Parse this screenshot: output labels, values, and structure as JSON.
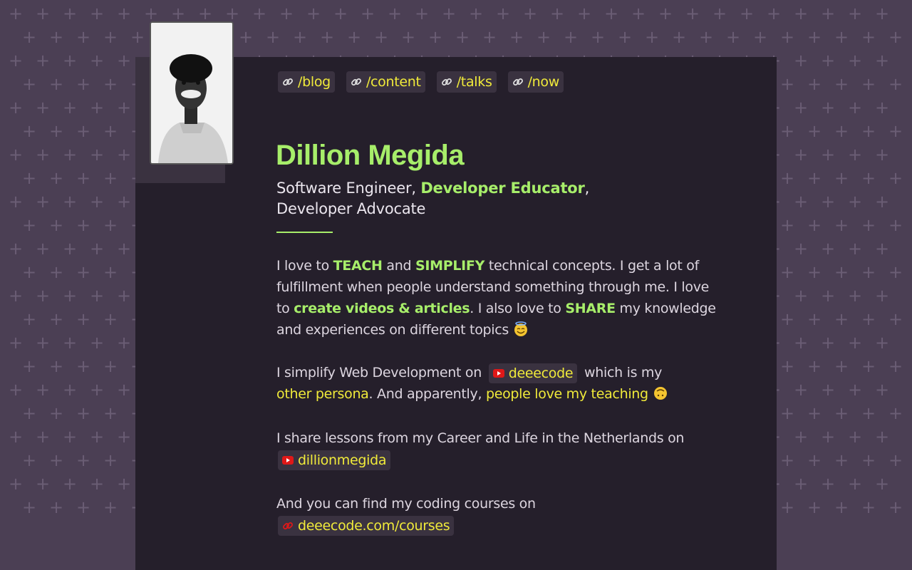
{
  "nav": [
    {
      "label": "/blog",
      "icon": "link-icon"
    },
    {
      "label": "/content",
      "icon": "link-icon"
    },
    {
      "label": "/talks",
      "icon": "link-icon"
    },
    {
      "label": "/now",
      "icon": "link-icon"
    }
  ],
  "profile": {
    "name": "Dillion Megida",
    "role_1": "Software Engineer, ",
    "role_highlight": "Developer Educator",
    "role_2": ",",
    "role_3": "Developer Advocate"
  },
  "about": {
    "p1_a": "I love to ",
    "p1_teach": "TEACH",
    "p1_b": " and ",
    "p1_simplify": "SIMPLIFY",
    "p1_c": " technical concepts. I get a lot of fulfillment when people understand something through me. I love to ",
    "p1_create": "create videos & articles",
    "p1_d": ". I also love to ",
    "p1_share": "SHARE",
    "p1_e": " my knowledge and experiences on different topics",
    "p2_a": "I simplify Web Development on",
    "p2_channel": "deeecode",
    "p2_b": "which is my",
    "p2_persona": "other persona",
    "p2_c": ". And apparently, ",
    "p2_teaching": "people love my teaching",
    "p3_a": "I share lessons from my Career and Life in the Netherlands on",
    "p3_channel": "dillionmegida",
    "p4_a": "And you can find my coding courses on",
    "p4_link": "deeecode.com/courses"
  },
  "colors": {
    "background": "#4b3f54",
    "card": "#251f2b",
    "accent_green": "#a7ee6a",
    "accent_yellow": "#f0ea3a",
    "youtube_red": "#e01818"
  }
}
